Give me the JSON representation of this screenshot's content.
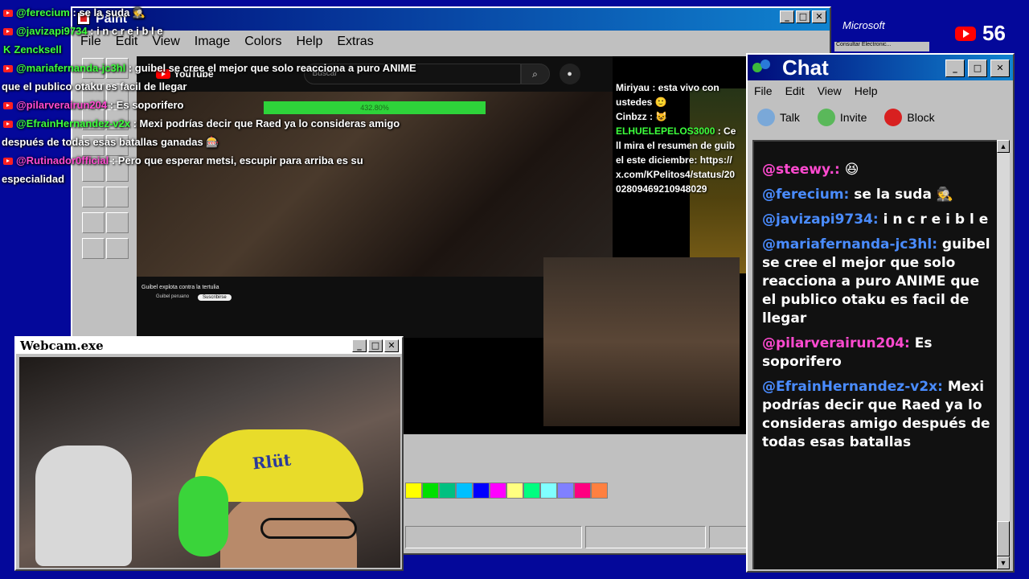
{
  "overlay_chat": [
    {
      "platform": "youtube",
      "user": "@ferecium",
      "text": " : se la suda 🕵️",
      "color": "green"
    },
    {
      "platform": "youtube",
      "user": "@javizapi9734",
      "text": " : i n c r e i b l e",
      "color": "green"
    },
    {
      "platform": "kick",
      "user": "Zencksell",
      "text": "",
      "color": "green"
    },
    {
      "platform": "youtube",
      "user": "@mariafernanda-jc3hl",
      "text": " : guibel se cree el mejor que solo reacciona a puro ANIME que el publico otaku es facil de llegar",
      "color": "green"
    },
    {
      "platform": "youtube",
      "user": "@pilarverairun204",
      "text": " : Es soporifero",
      "color": "pink"
    },
    {
      "platform": "youtube",
      "user": "@EfrainHernandez-v2x",
      "text": " : Mexi podrías decir que Raed ya lo consideras amigo después de todas esas batallas ganadas 🎰",
      "color": "green"
    },
    {
      "platform": "youtube",
      "user": "@Rutinador0fficial",
      "text": " : Pero que esperar metsi, escupir para arriba es su especialidad",
      "color": "pink"
    }
  ],
  "paint": {
    "title": "Paint",
    "menu": [
      "File",
      "Edit",
      "View",
      "Image",
      "Colors",
      "Help",
      "Extras"
    ],
    "palette": [
      "#ffff00",
      "#00e000",
      "#00c080",
      "#00c0ff",
      "#0000ff",
      "#ff00ff",
      "#ffff80",
      "#00ff80",
      "#80ffff",
      "#8080ff",
      "#ff0080",
      "#ff8040"
    ]
  },
  "youtube": {
    "logo": "YouTube",
    "search_placeholder": "Buscar",
    "progress_label": "432.80%",
    "video_title": "Guibel explota contra la tertulia",
    "channel": "Guibel peruano",
    "subscribe": "Suscribirse"
  },
  "side_chat": [
    {
      "user": "Miriyau",
      "text": " : esta vivo con ustedes 🙂"
    },
    {
      "user": "Cinbzz",
      "text": " : 😺"
    },
    {
      "user": "ELHUELEPELOS3000",
      "text": " : Cell mira el resumen de guibel este diciembre: https://x.com/KPelitos4/status/2002809469210948029"
    }
  ],
  "webcam": {
    "title": "Webcam.exe",
    "cap_text": "Rlüt"
  },
  "chat_window": {
    "title": "Chat",
    "menu": [
      "File",
      "Edit",
      "View",
      "Help"
    ],
    "toolbar": {
      "talk": "Talk",
      "invite": "Invite",
      "block": "Block"
    },
    "messages": [
      {
        "user": "@steewy.:",
        "text": " 😆",
        "color": "blue"
      },
      {
        "user": "@ferecium:",
        "text": " se la suda 🕵️",
        "color": "blue"
      },
      {
        "user": "@javizapi9734:",
        "text": " i n c r e i b l e",
        "color": "blue"
      },
      {
        "user": "@mariafernanda-jc3hl:",
        "text": " guibel se cree el mejor que solo reacciona a puro ANIME que el publico otaku es facil de llegar",
        "color": "blue"
      },
      {
        "user": "@pilarverairun204:",
        "text": " Es soporifero",
        "color": "pink"
      },
      {
        "user": "@EfrainHernandez-v2x:",
        "text": " Mexi podrías decir que Raed ya lo consideras amigo después de todas esas batallas",
        "color": "blue"
      }
    ]
  },
  "viewers": {
    "count": "56",
    "ms_logo": "Microsoft",
    "ms_sub": "Consultar Electronic..."
  }
}
